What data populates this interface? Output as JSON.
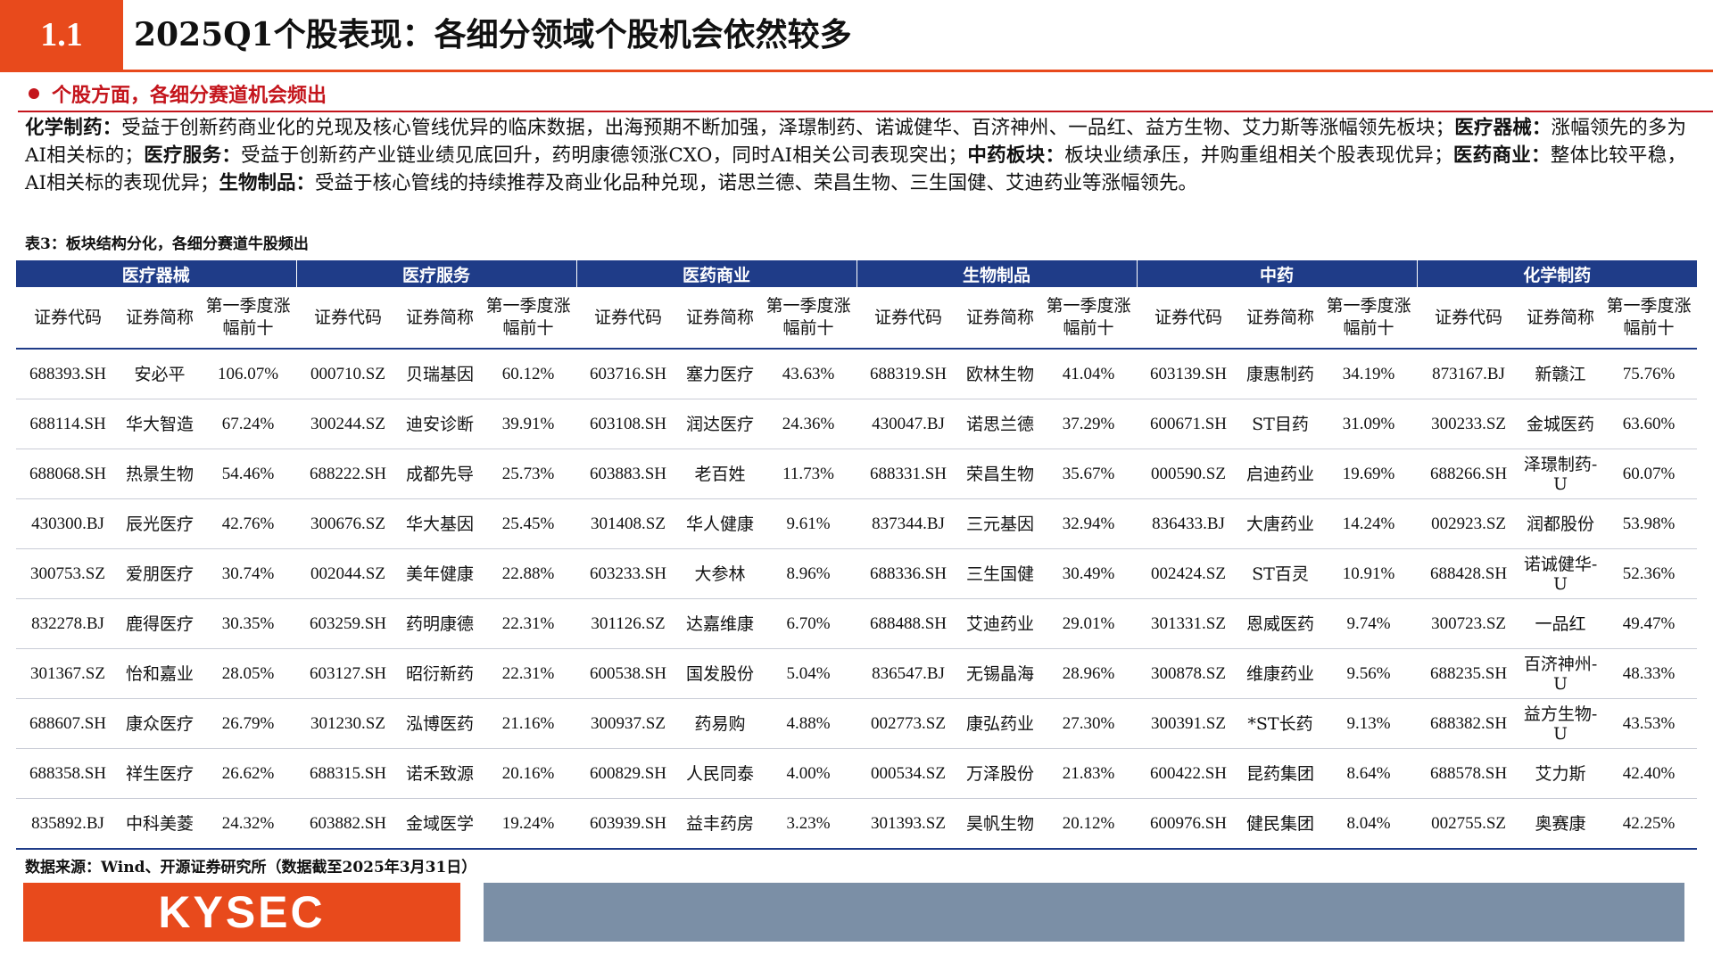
{
  "header": {
    "section_number": "1.1",
    "title": "2025Q1个股表现：各细分领域个股机会依然较多"
  },
  "bullet": "个股方面，各细分赛道机会频出",
  "paragraph": [
    {
      "label": "化学制药：",
      "text": "受益于创新药商业化的兑现及核心管线优异的临床数据，出海预期不断加强，泽璟制药、诺诚健华、百济神州、一品红、益方生物、艾力斯等涨幅领先板块；"
    },
    {
      "label": "医疗器械：",
      "text": "涨幅领先的多为AI相关标的；"
    },
    {
      "label": "医疗服务：",
      "text": "受益于创新药产业链业绩见底回升，药明康德领涨CXO，同时AI相关公司表现突出；"
    },
    {
      "label": "中药板块：",
      "text": "板块业绩承压，并购重组相关个股表现优异；"
    },
    {
      "label": "医药商业：",
      "text": "整体比较平稳，AI相关标的表现优异；"
    },
    {
      "label": "生物制品：",
      "text": "受益于核心管线的持续推荐及商业化品种兑现，诺思兰德、荣昌生物、三生国健、艾迪药业等涨幅领先。"
    }
  ],
  "table_title": "表3：板块结构分化，各细分赛道牛股频出",
  "table": {
    "groups": [
      "医疗器械",
      "医疗服务",
      "医药商业",
      "生物制品",
      "中药",
      "化学制药"
    ],
    "columns": [
      "证券代码",
      "证券简称",
      "第一季度涨幅前十"
    ],
    "rows": [
      [
        [
          "688393.SH",
          "安必平",
          "106.07%"
        ],
        [
          "000710.SZ",
          "贝瑞基因",
          "60.12%"
        ],
        [
          "603716.SH",
          "塞力医疗",
          "43.63%"
        ],
        [
          "688319.SH",
          "欧林生物",
          "41.04%"
        ],
        [
          "603139.SH",
          "康惠制药",
          "34.19%"
        ],
        [
          "873167.BJ",
          "新赣江",
          "75.76%"
        ]
      ],
      [
        [
          "688114.SH",
          "华大智造",
          "67.24%"
        ],
        [
          "300244.SZ",
          "迪安诊断",
          "39.91%"
        ],
        [
          "603108.SH",
          "润达医疗",
          "24.36%"
        ],
        [
          "430047.BJ",
          "诺思兰德",
          "37.29%"
        ],
        [
          "600671.SH",
          "ST目药",
          "31.09%"
        ],
        [
          "300233.SZ",
          "金城医药",
          "63.60%"
        ]
      ],
      [
        [
          "688068.SH",
          "热景生物",
          "54.46%"
        ],
        [
          "688222.SH",
          "成都先导",
          "25.73%"
        ],
        [
          "603883.SH",
          "老百姓",
          "11.73%"
        ],
        [
          "688331.SH",
          "荣昌生物",
          "35.67%"
        ],
        [
          "000590.SZ",
          "启迪药业",
          "19.69%"
        ],
        [
          "688266.SH",
          "泽璟制药-U",
          "60.07%"
        ]
      ],
      [
        [
          "430300.BJ",
          "辰光医疗",
          "42.76%"
        ],
        [
          "300676.SZ",
          "华大基因",
          "25.45%"
        ],
        [
          "301408.SZ",
          "华人健康",
          "9.61%"
        ],
        [
          "837344.BJ",
          "三元基因",
          "32.94%"
        ],
        [
          "836433.BJ",
          "大唐药业",
          "14.24%"
        ],
        [
          "002923.SZ",
          "润都股份",
          "53.98%"
        ]
      ],
      [
        [
          "300753.SZ",
          "爱朋医疗",
          "30.74%"
        ],
        [
          "002044.SZ",
          "美年健康",
          "22.88%"
        ],
        [
          "603233.SH",
          "大参林",
          "8.96%"
        ],
        [
          "688336.SH",
          "三生国健",
          "30.49%"
        ],
        [
          "002424.SZ",
          "ST百灵",
          "10.91%"
        ],
        [
          "688428.SH",
          "诺诚健华-U",
          "52.36%"
        ]
      ],
      [
        [
          "832278.BJ",
          "鹿得医疗",
          "30.35%"
        ],
        [
          "603259.SH",
          "药明康德",
          "22.31%"
        ],
        [
          "301126.SZ",
          "达嘉维康",
          "6.70%"
        ],
        [
          "688488.SH",
          "艾迪药业",
          "29.01%"
        ],
        [
          "301331.SZ",
          "恩威医药",
          "9.74%"
        ],
        [
          "300723.SZ",
          "一品红",
          "49.47%"
        ]
      ],
      [
        [
          "301367.SZ",
          "怡和嘉业",
          "28.05%"
        ],
        [
          "603127.SH",
          "昭衍新药",
          "22.31%"
        ],
        [
          "600538.SH",
          "国发股份",
          "5.04%"
        ],
        [
          "836547.BJ",
          "无锡晶海",
          "28.96%"
        ],
        [
          "300878.SZ",
          "维康药业",
          "9.56%"
        ],
        [
          "688235.SH",
          "百济神州-U",
          "48.33%"
        ]
      ],
      [
        [
          "688607.SH",
          "康众医疗",
          "26.79%"
        ],
        [
          "301230.SZ",
          "泓博医药",
          "21.16%"
        ],
        [
          "300937.SZ",
          "药易购",
          "4.88%"
        ],
        [
          "002773.SZ",
          "康弘药业",
          "27.30%"
        ],
        [
          "300391.SZ",
          "*ST长药",
          "9.13%"
        ],
        [
          "688382.SH",
          "益方生物-U",
          "43.53%"
        ]
      ],
      [
        [
          "688358.SH",
          "祥生医疗",
          "26.62%"
        ],
        [
          "688315.SH",
          "诺禾致源",
          "20.16%"
        ],
        [
          "600829.SH",
          "人民同泰",
          "4.00%"
        ],
        [
          "000534.SZ",
          "万泽股份",
          "21.83%"
        ],
        [
          "600422.SH",
          "昆药集团",
          "8.64%"
        ],
        [
          "688578.SH",
          "艾力斯",
          "42.40%"
        ]
      ],
      [
        [
          "835892.BJ",
          "中科美菱",
          "24.32%"
        ],
        [
          "603882.SH",
          "金域医学",
          "19.24%"
        ],
        [
          "603939.SH",
          "益丰药房",
          "3.23%"
        ],
        [
          "301393.SZ",
          "昊帆生物",
          "20.12%"
        ],
        [
          "600976.SH",
          "健民集团",
          "8.04%"
        ],
        [
          "002755.SZ",
          "奥赛康",
          "42.25%"
        ]
      ]
    ]
  },
  "source": "数据来源：Wind、开源证券研究所（数据截至2025年3月31日）",
  "footer": {
    "logo_text": "KYSEC"
  },
  "colors": {
    "accent_orange": "#e84a1c",
    "bullet_red": "#c4151c",
    "table_header_blue": "#1f3c88",
    "footer_gray_blue": "#7b8fa6"
  }
}
